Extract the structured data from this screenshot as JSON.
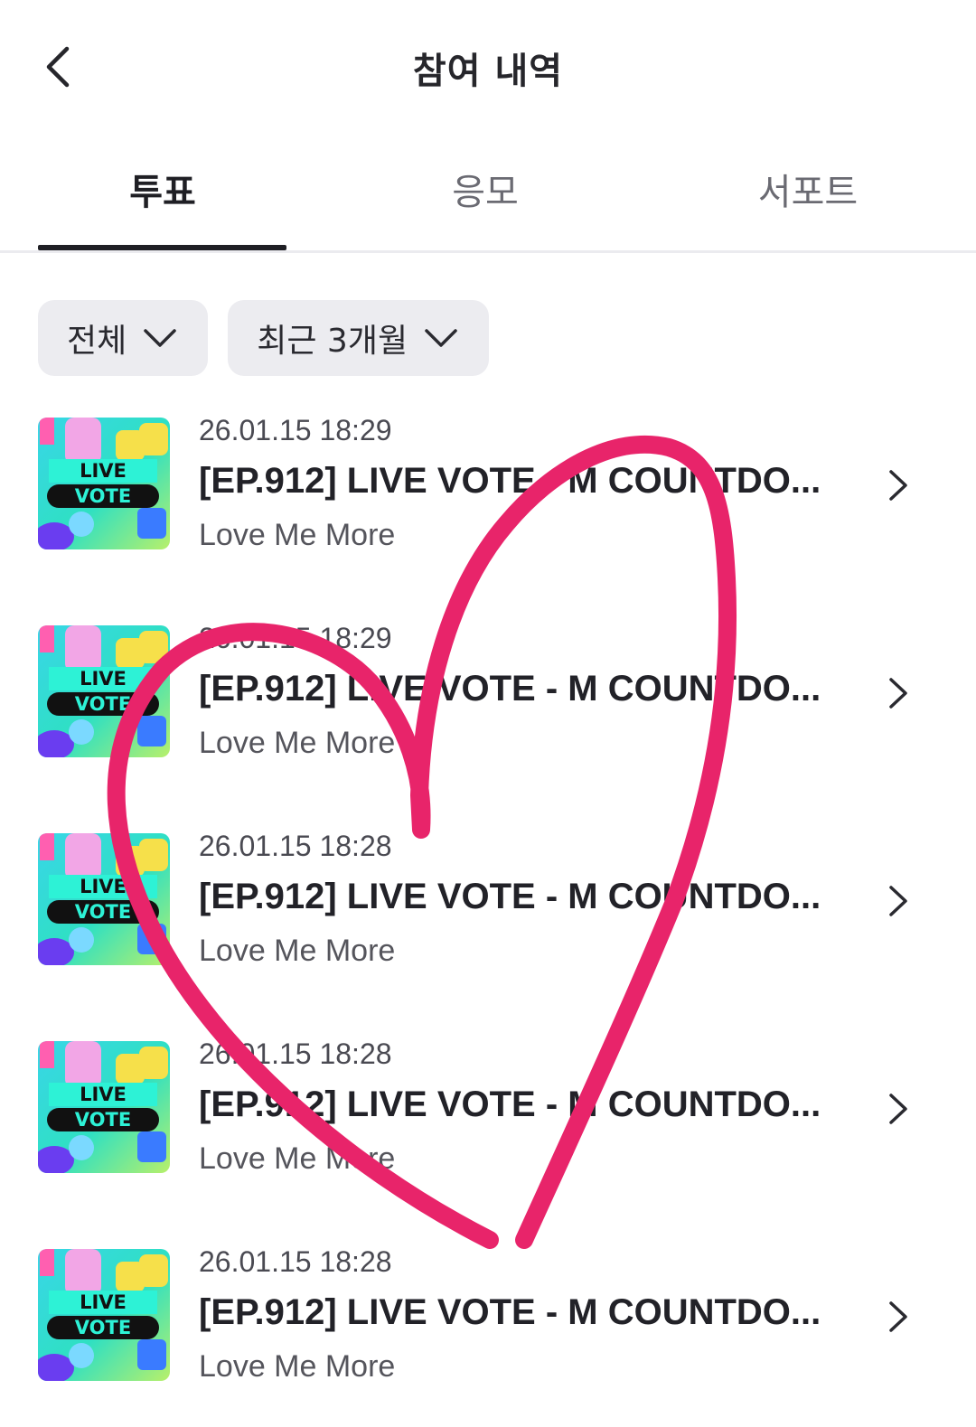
{
  "header": {
    "title": "참여 내역",
    "back_icon": "chevron-left-icon"
  },
  "tabs": [
    {
      "label": "투표",
      "active": true
    },
    {
      "label": "응모",
      "active": false
    },
    {
      "label": "서포트",
      "active": false
    }
  ],
  "filters": [
    {
      "label": "전체",
      "icon": "chevron-down-icon"
    },
    {
      "label": "최근 3개월",
      "icon": "chevron-down-icon"
    }
  ],
  "list": {
    "items": [
      {
        "date": "26.01.15 18:29",
        "title": "[EP.912] LIVE VOTE - M COUNTDO...",
        "subtitle": "Love Me More"
      },
      {
        "date": "26.01.15 18:29",
        "title": "[EP.912] LIVE VOTE - M COUNTDO...",
        "subtitle": "Love Me More"
      },
      {
        "date": "26.01.15 18:28",
        "title": "[EP.912] LIVE VOTE - M COUNTDO...",
        "subtitle": "Love Me More"
      },
      {
        "date": "26.01.15 18:28",
        "title": "[EP.912] LIVE VOTE - M COUNTDO...",
        "subtitle": "Love Me More"
      },
      {
        "date": "26.01.15 18:28",
        "title": "[EP.912] LIVE VOTE - M COUNTDO...",
        "subtitle": "Love Me More"
      }
    ],
    "thumbnail_text": [
      "LIVE",
      "VOTE"
    ]
  },
  "colors": {
    "heart_stroke": "#e8246a",
    "tab_indicator": "#1f1f24",
    "chip_bg": "#ececf0"
  }
}
